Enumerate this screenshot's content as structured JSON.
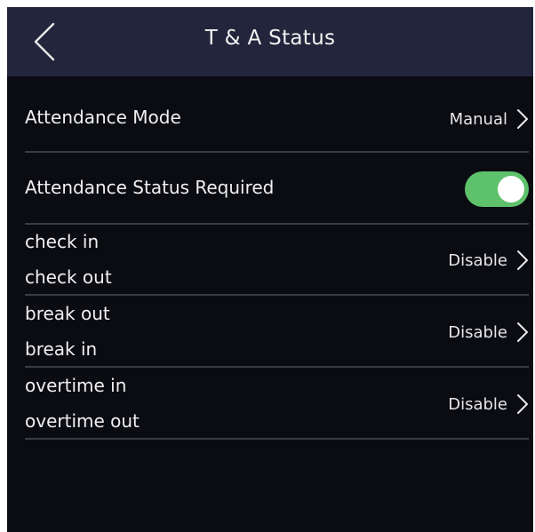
{
  "header": {
    "title": "T & A Status",
    "back_icon": "chevron-left-icon"
  },
  "attendance_mode": {
    "label": "Attendance Mode",
    "value": "Manual"
  },
  "status_required": {
    "label": "Attendance Status Required",
    "enabled": true,
    "toggle_color": "#5ec16b"
  },
  "status_rows": [
    {
      "line1": "check in",
      "line2": "check out",
      "value": "Disable"
    },
    {
      "line1": "break out",
      "line2": "break in",
      "value": "Disable"
    },
    {
      "line1": "overtime in",
      "line2": "overtime out",
      "value": "Disable"
    }
  ],
  "colors": {
    "background": "#0b0c12",
    "header": "#23253c",
    "divider": "#3a3b44"
  }
}
